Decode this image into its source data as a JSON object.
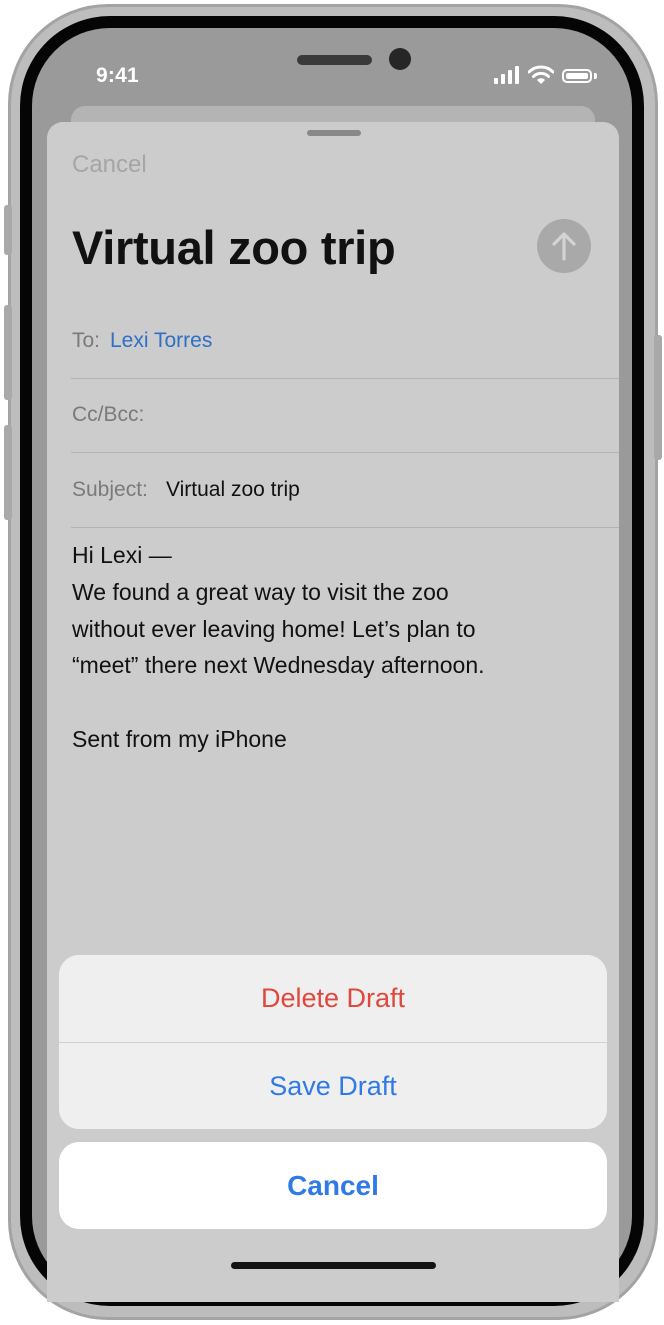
{
  "status_bar": {
    "time": "9:41"
  },
  "compose": {
    "cancel_label": "Cancel",
    "title": "Virtual zoo trip",
    "to_label": "To:",
    "to_value": "Lexi Torres",
    "cc_label": "Cc/Bcc:",
    "subject_label": "Subject:",
    "subject_value": "Virtual zoo trip",
    "body": {
      "greeting": "Hi Lexi —",
      "line1": "We found a great way to visit the zoo",
      "line2": "without ever leaving home! Let’s plan to",
      "line3": "“meet” there next Wednesday afternoon.",
      "signature": "Sent from my iPhone"
    }
  },
  "action_sheet": {
    "delete_label": "Delete Draft",
    "save_label": "Save Draft",
    "cancel_label": "Cancel"
  },
  "colors": {
    "destructive": "#e0483d",
    "accent": "#2f7ae5",
    "link": "#2f6fc6"
  }
}
